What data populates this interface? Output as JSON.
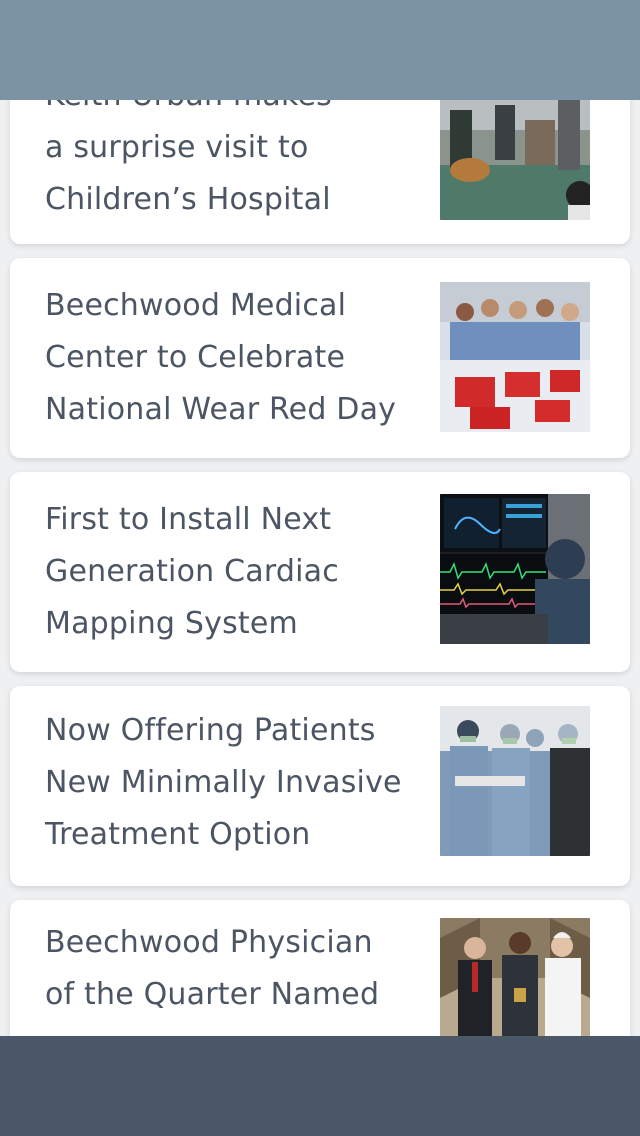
{
  "articles": [
    {
      "title_lines": [
        "Keith Urban makes",
        "a surprise visit to",
        "Children’s Hospital"
      ],
      "image": "keith-urban-visit-photo"
    },
    {
      "title_lines": [
        "Beechwood Medical",
        "Center to Celebrate",
        "National Wear Red Day"
      ],
      "image": "newborns-red-day-photo"
    },
    {
      "title_lines": [
        "First to Install Next",
        "Generation Cardiac",
        "Mapping System"
      ],
      "image": "cardiac-mapping-monitors-photo"
    },
    {
      "title_lines": [
        "Now Offering Patients",
        "New Minimally Invasive",
        "Treatment Option"
      ],
      "image": "surgical-team-photo"
    },
    {
      "title_lines": [
        "Beechwood Physician",
        "of the Quarter Named",
        ""
      ],
      "image": "physician-award-photo"
    }
  ]
}
